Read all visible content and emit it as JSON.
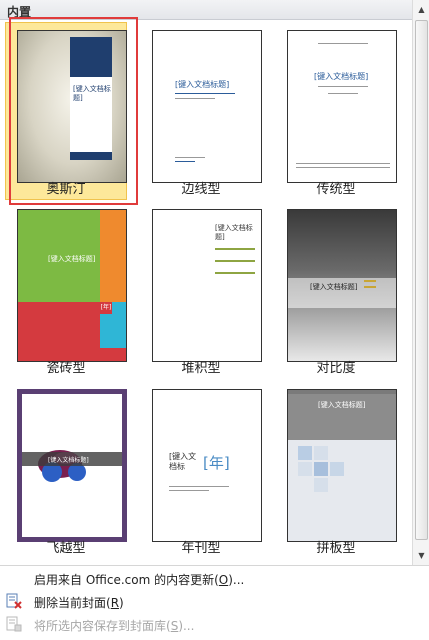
{
  "gallery": {
    "header": "内置",
    "items": [
      {
        "label": "奥斯汀",
        "selected": true
      },
      {
        "label": "边线型"
      },
      {
        "label": "传统型"
      },
      {
        "label": "瓷砖型"
      },
      {
        "label": "堆积型"
      },
      {
        "label": "对比度"
      },
      {
        "label": "飞越型"
      },
      {
        "label": "年刊型"
      },
      {
        "label": "拼板型"
      }
    ],
    "thumb_text": {
      "title": "[键入文档标题]",
      "title_short": "[键入文档标",
      "title_short2": "题]",
      "title_split_1": "[键入文档",
      "title_split_2": "标题]",
      "year": "[年]",
      "year_short": "[年]"
    }
  },
  "menu": {
    "items": [
      {
        "label": "启用来自 Office.com 的内容更新(",
        "hotkey": "O",
        "suffix": ")...",
        "enabled": true
      },
      {
        "label": "删除当前封面(",
        "hotkey": "R",
        "suffix": ")",
        "enabled": true
      },
      {
        "label": "将所选内容保存到封面库(",
        "hotkey": "S",
        "suffix": ")...",
        "enabled": false
      }
    ]
  },
  "colors": {
    "selected_bg": "#fde89a",
    "selection_outline": "#e03b3b",
    "austin_blue": "#1f3e6e",
    "tile_green": "#7dba43",
    "tile_orange": "#ef8a2e",
    "tile_red": "#d43a3f",
    "tile_cyan": "#2fb6d6",
    "flyby_purple": "#5a3f73"
  }
}
